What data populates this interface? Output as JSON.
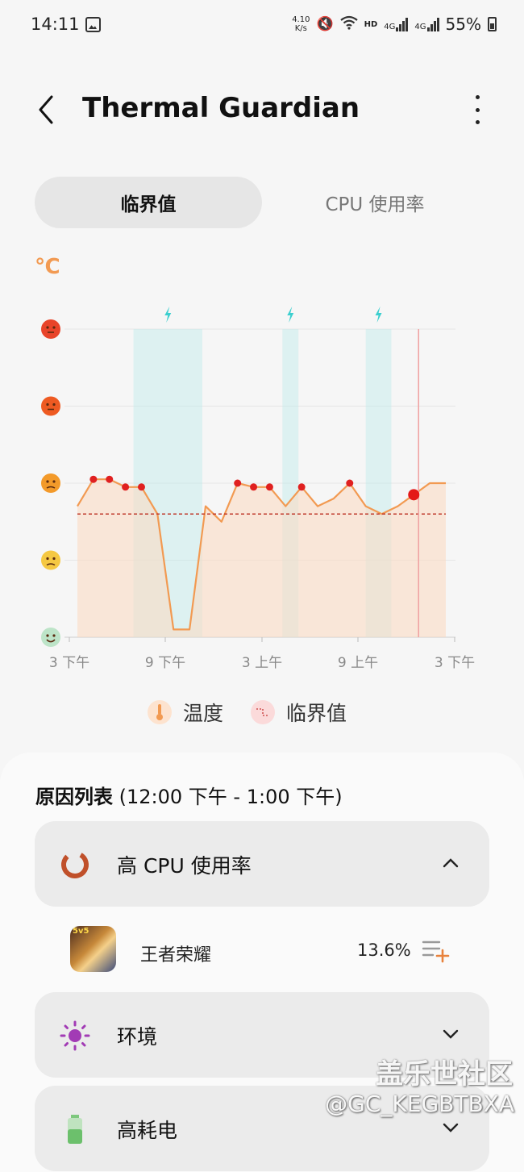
{
  "status_bar": {
    "time": "14:11",
    "net_speed_value": "4.10",
    "net_speed_unit": "K/s",
    "hd": "HD",
    "signal1": "4G",
    "signal2": "4G",
    "battery": "55%"
  },
  "header": {
    "title": "Thermal Guardian"
  },
  "tabs": [
    {
      "label": "临界值",
      "selected": true
    },
    {
      "label": "CPU 使用率",
      "selected": false
    }
  ],
  "chart_data": {
    "type": "line",
    "unit": "℃",
    "x_ticks": [
      "3 下午",
      "9 下午",
      "3 上午",
      "9 上午",
      "3 下午"
    ],
    "y_levels": [
      "very-hot-face",
      "hot-face",
      "warm-face",
      "normal-face",
      "cool-face"
    ],
    "series": [
      {
        "name": "温度",
        "color": "#f29a52",
        "points": [
          {
            "x": 0,
            "y": 1.7
          },
          {
            "x": 1,
            "y": 2.05,
            "marker": true
          },
          {
            "x": 2,
            "y": 2.05,
            "marker": true
          },
          {
            "x": 3,
            "y": 1.95,
            "marker": true
          },
          {
            "x": 4,
            "y": 1.95,
            "marker": true
          },
          {
            "x": 5,
            "y": 1.6
          },
          {
            "x": 6,
            "y": 0.1
          },
          {
            "x": 7,
            "y": 0.1
          },
          {
            "x": 8,
            "y": 1.7
          },
          {
            "x": 9,
            "y": 1.5
          },
          {
            "x": 10,
            "y": 2.0,
            "marker": true
          },
          {
            "x": 11,
            "y": 1.95,
            "marker": true
          },
          {
            "x": 12,
            "y": 1.95,
            "marker": true
          },
          {
            "x": 13,
            "y": 1.7
          },
          {
            "x": 14,
            "y": 1.95,
            "marker": true
          },
          {
            "x": 15,
            "y": 1.7
          },
          {
            "x": 16,
            "y": 1.8
          },
          {
            "x": 17,
            "y": 2.0,
            "marker": true
          },
          {
            "x": 18,
            "y": 1.7
          },
          {
            "x": 19,
            "y": 1.6
          },
          {
            "x": 20,
            "y": 1.7
          },
          {
            "x": 21,
            "y": 1.85,
            "current": true
          },
          {
            "x": 22,
            "y": 2.0
          },
          {
            "x": 23,
            "y": 2.0
          }
        ]
      },
      {
        "name": "临界值",
        "color": "#c0392b",
        "value": 1.6,
        "style": "dashed"
      }
    ],
    "x_range": [
      0,
      23
    ],
    "y_range": [
      0,
      4
    ],
    "charging_periods": [
      [
        3.5,
        7.8
      ],
      [
        12.8,
        13.8
      ],
      [
        18.0,
        19.6
      ]
    ],
    "now_x": 21.3,
    "grid": true,
    "legend": [
      {
        "label": "温度",
        "icon": "thermometer-icon",
        "color": "#f29a52"
      },
      {
        "label": "临界值",
        "icon": "threshold-step-icon",
        "color": "#e07070"
      }
    ]
  },
  "reasons": {
    "title": "原因列表",
    "range": "(12:00 下午 - 1:00 下午)",
    "items": [
      {
        "label": "高 CPU 使用率",
        "icon": "cpu-ring-icon",
        "expanded": true
      },
      {
        "label": "环境",
        "icon": "sun-icon",
        "expanded": false
      },
      {
        "label": "高耗电",
        "icon": "battery-icon",
        "expanded": false
      }
    ],
    "apps": [
      {
        "name": "王者荣耀",
        "percent": "13.6%",
        "badge": "5v5"
      }
    ]
  },
  "watermark": {
    "line1": "盖乐世社区",
    "line2": "@GC_KEGBTBXA"
  }
}
